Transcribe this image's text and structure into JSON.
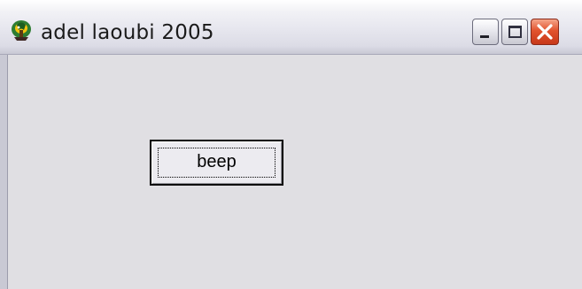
{
  "window": {
    "title": "adel laoubi 2005",
    "app_icon": "app-logo-icon",
    "controls": {
      "minimize_icon": "minimize-icon",
      "maximize_icon": "maximize-icon",
      "close_icon": "close-icon"
    }
  },
  "client": {
    "beep_button": {
      "label": "beep"
    }
  },
  "colors": {
    "client_background": "#e0dfe3",
    "close_button": "#e2532e",
    "button_text": "#000000"
  }
}
